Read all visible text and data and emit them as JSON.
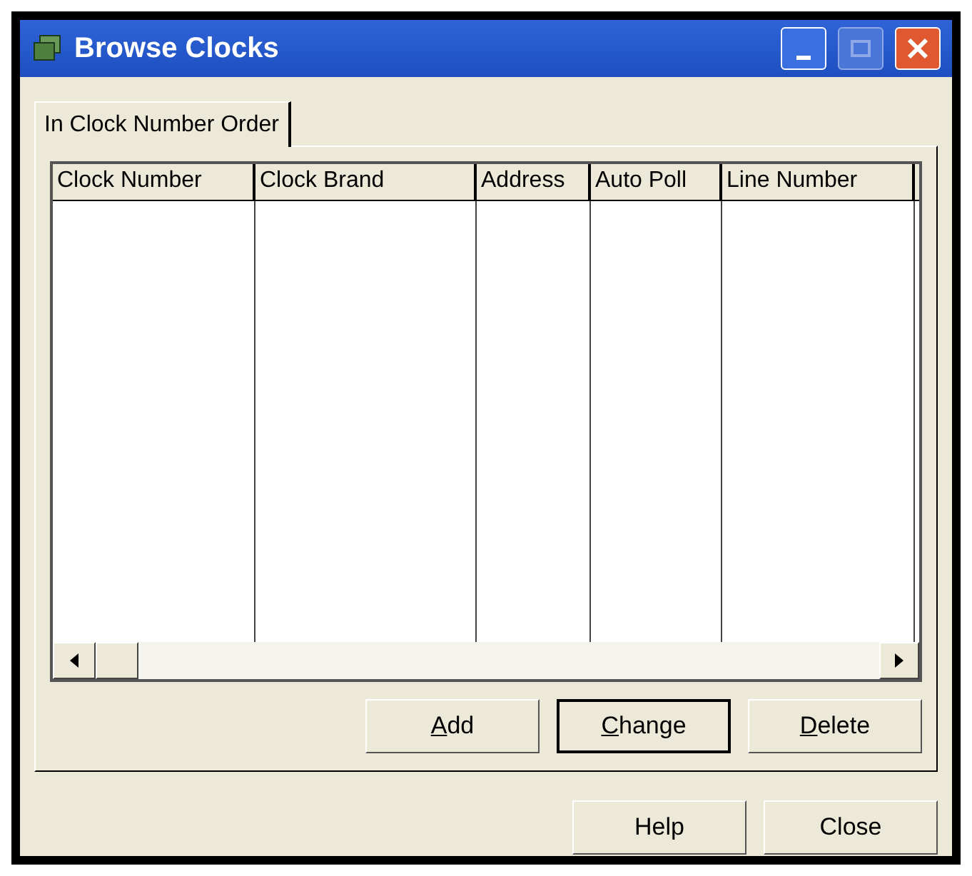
{
  "window": {
    "title": "Browse Clocks"
  },
  "tabs": [
    {
      "label": "In Clock Number Order",
      "selected": true
    }
  ],
  "table": {
    "columns": [
      {
        "label": "Clock Number"
      },
      {
        "label": "Clock Brand"
      },
      {
        "label": "Address"
      },
      {
        "label": "Auto Poll"
      },
      {
        "label": "Line Number"
      }
    ]
  },
  "panel_buttons": [
    {
      "label": "Add",
      "first_letter_underlined": true,
      "default": false
    },
    {
      "label": "Change",
      "first_letter_underlined": true,
      "default": true
    },
    {
      "label": "Delete",
      "first_letter_underlined": true,
      "default": false
    }
  ],
  "dialog_buttons": [
    {
      "label": "Help",
      "default": false
    },
    {
      "label": "Close",
      "default": false
    }
  ]
}
